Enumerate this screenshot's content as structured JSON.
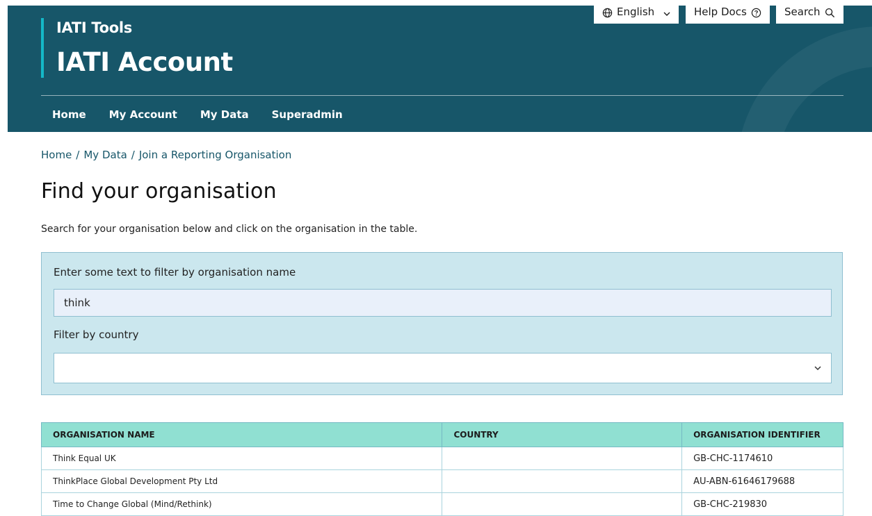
{
  "header": {
    "utility": {
      "language": "English",
      "help_docs": "Help Docs",
      "search": "Search"
    },
    "brand_small": "IATI Tools",
    "brand_large": "IATI Account",
    "nav": [
      "Home",
      "My Account",
      "My Data",
      "Superadmin"
    ],
    "background_color": "#175669",
    "accent_color": "#14b8c8"
  },
  "breadcrumb": [
    "Home",
    "My Data",
    "Join a Reporting Organisation"
  ],
  "page_title": "Find your organisation",
  "intro": "Search for your organisation below and click on the organisation in the table.",
  "filters": {
    "name_label": "Enter some text to filter by organisation name",
    "name_value": "think",
    "country_label": "Filter by country",
    "country_value": ""
  },
  "table": {
    "headers": [
      "ORGANISATION NAME",
      "COUNTRY",
      "ORGANISATION IDENTIFIER"
    ],
    "rows": [
      [
        "Think Equal UK",
        "",
        "GB-CHC-1174610"
      ],
      [
        "ThinkPlace Global Development Pty Ltd",
        "",
        "AU-ABN-61646179688"
      ],
      [
        "Time to Change Global (Mind/Rethink)",
        "",
        "GB-CHC-219830"
      ]
    ],
    "header_color": "#90e0d2"
  }
}
